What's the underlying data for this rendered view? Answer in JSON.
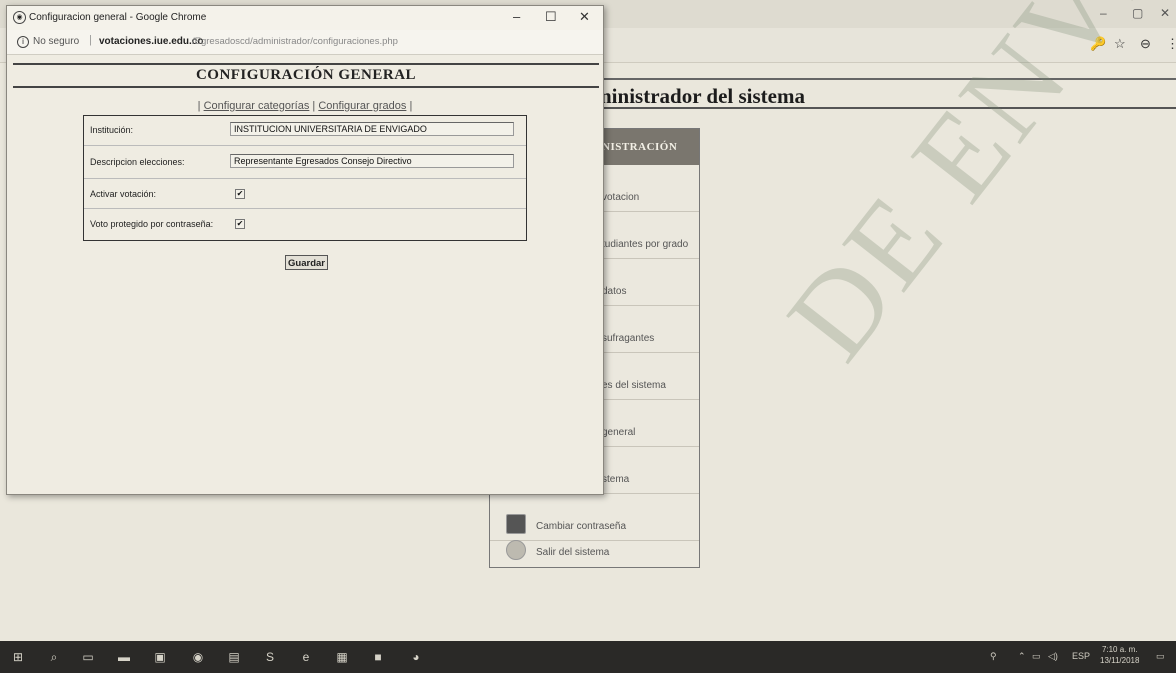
{
  "popup": {
    "window_title": "Configuracion general - Google Chrome",
    "controls": {
      "minimize": "–",
      "maximize": "☐",
      "close": "✕"
    },
    "address": {
      "security": "No seguro",
      "host": "votaciones.iue.edu.co",
      "path": "/Egresadoscd/administrador/configuraciones.php"
    },
    "heading": "CONFIGURACIÓN GENERAL",
    "links": {
      "categories": "Configurar categorías",
      "grades": "Configurar grados",
      "sep": "|"
    },
    "fields": [
      {
        "label": "Institución:",
        "value": "INSTITUCION UNIVERSITARIA DE ENVIGADO"
      },
      {
        "label": "Descripcion elecciones:",
        "value": "Representante Egresados Consejo Directivo"
      }
    ],
    "checks": [
      {
        "label": "Activar votación:",
        "mark": "✔"
      },
      {
        "label": "Voto protegido por contraseña:",
        "mark": "✔"
      }
    ],
    "save_label": "Guardar"
  },
  "background": {
    "win_controls": {
      "minimize": "–",
      "restore": "▢",
      "close": "✕"
    },
    "toolbar_icons": [
      "key-icon",
      "star-icon",
      "profile-icon",
      "menu-icon"
    ],
    "title_fragment": "ninistrador del sistema",
    "menu_head": "NISTRACIÓN",
    "menu_items": [
      "votacion",
      "tudiantes por grado",
      "datos",
      "sufragantes",
      "es del sistema",
      "general",
      "stema",
      "Cambiar contraseña",
      "Salir del sistema"
    ],
    "watermark": "DE ENVIGAD"
  },
  "taskbar": {
    "lang": "ESP",
    "time": "7:10 a. m.",
    "date": "13/11/2018"
  }
}
